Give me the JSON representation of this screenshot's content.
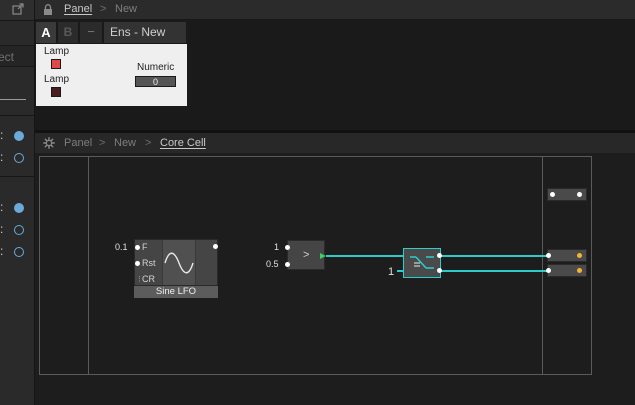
{
  "left_panel": {
    "field_text": "ect",
    "rows": [
      {
        "colon": ":",
        "dot": "filled"
      },
      {
        "colon": ":",
        "dot": "ring"
      },
      {
        "colon": ":",
        "dot": "filled"
      },
      {
        "colon": ":",
        "dot": "ring"
      },
      {
        "colon": ":",
        "dot": "ring"
      }
    ]
  },
  "top_breadcrumb": {
    "items": [
      "Panel",
      "New"
    ],
    "separator": ">"
  },
  "ensemble": {
    "tabs": [
      "A",
      "B"
    ],
    "minus": "−",
    "title": "Ens - New"
  },
  "panel": {
    "lamp1_label": "Lamp",
    "lamp2_label": "Lamp",
    "numeric_label": "Numeric",
    "numeric_value": "0",
    "lamp1_color": "#e04848",
    "lamp2_color": "#4a1e1e"
  },
  "struct_breadcrumb": {
    "items": [
      "Panel",
      "New",
      "Core Cell"
    ],
    "separator": ">"
  },
  "lfo": {
    "label": "Sine LFO",
    "ports": [
      "F",
      "Rst",
      "CR"
    ],
    "consts": [
      "0.1"
    ]
  },
  "compare": {
    "symbol": ">",
    "consts": [
      "1",
      "0.5"
    ]
  },
  "switch_module": {
    "const": "1"
  },
  "colors": {
    "wire": "#2ec9c9",
    "accent_blue": "#6aa9d8",
    "out_dot": "#f2b236"
  }
}
